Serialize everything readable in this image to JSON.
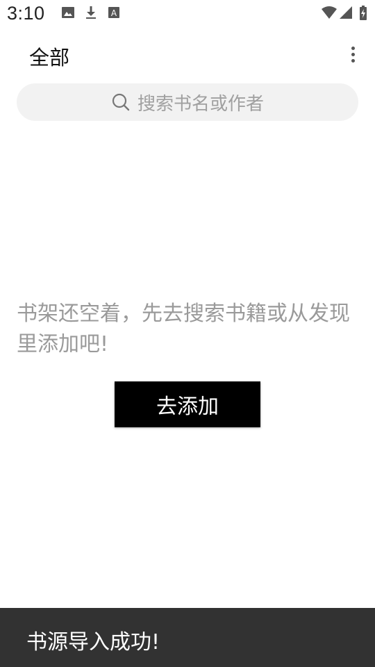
{
  "status_bar": {
    "time": "3:10",
    "icons": [
      "image-icon",
      "download-icon",
      "text-icon",
      "wifi-icon",
      "signal-icon",
      "battery-charging-icon"
    ]
  },
  "app_bar": {
    "title": "全部",
    "menu_icon": "more-vert-icon"
  },
  "search": {
    "icon": "search-icon",
    "placeholder": "搜索书名或作者"
  },
  "empty_state": {
    "message": "书架还空着，先去搜索书籍或从发现里添加吧!",
    "button_label": "去添加"
  },
  "snackbar": {
    "message": "书源导入成功!"
  },
  "colors": {
    "background": "#ffffff",
    "search_bg": "#f2f2f2",
    "placeholder": "#a0a0a0",
    "empty_text": "#9a9a9a",
    "button_bg": "#000000",
    "button_text": "#ffffff",
    "snackbar_bg": "#323232"
  }
}
